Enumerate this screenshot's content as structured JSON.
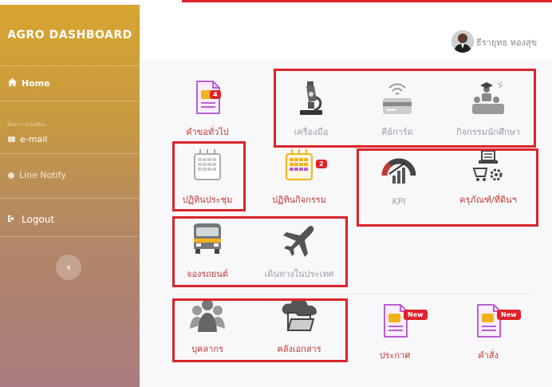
{
  "sidebar": {
    "brand": "AGRO DASHBOARD",
    "home": "Home",
    "section": "ตั้งค่าการแจ้งเตือน",
    "email": "e-mail",
    "line": "Line Notify",
    "logout": "Logout",
    "collapse": "‹"
  },
  "user": {
    "name": "ธีรายุทธ ทองสุข"
  },
  "tiles": {
    "general": {
      "label": "คำขอทั่วไป",
      "badge": "4"
    },
    "tools": {
      "label": "เครื่องมือ"
    },
    "keycard": {
      "label": "คีย์การ์ด"
    },
    "activities": {
      "label": "กิจกรรมนักศึกษา"
    },
    "meeting": {
      "label": "ปฏิทินประชุม"
    },
    "calendar": {
      "label": "ปฏิทินกิจกรรม",
      "badge": "2"
    },
    "kpi": {
      "label": "KPI"
    },
    "assets": {
      "label": "ครุภัณฑ์/ที่ดินฯ"
    },
    "car": {
      "label": "จองรถยนต์"
    },
    "travel": {
      "label": "เดินทางในประเทศ"
    },
    "staff": {
      "label": "บุคลากร"
    },
    "docs": {
      "label": "คลังเอกสาร"
    },
    "announce": {
      "label": "ประกาศ",
      "badge": "New"
    },
    "orders": {
      "label": "คำสั่ง",
      "badge": "New"
    }
  },
  "colors": {
    "accent": "#c33a32",
    "badge": "#e0222a",
    "highlight": "#d9252b",
    "doc_purple": "#b95fd3",
    "doc_yellow": "#f2b21b"
  }
}
